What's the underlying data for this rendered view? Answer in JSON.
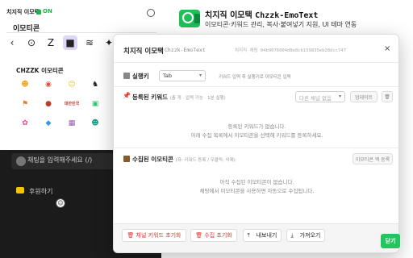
{
  "picker": {
    "title": "치지직 이모택",
    "status": "ON",
    "subtitle": "이모티콘",
    "section": "CHZZK 이모티콘",
    "tabs": [
      "‹",
      "⊙",
      "Z",
      "■",
      "≋",
      "✦"
    ],
    "emotes": [
      {
        "glyph": "☻",
        "color": "#f5a623"
      },
      {
        "glyph": "◉",
        "color": "#e74c3c"
      },
      {
        "glyph": "☺",
        "color": "#f1c40f"
      },
      {
        "glyph": "♞",
        "color": "#222"
      },
      {
        "glyph": "⚑",
        "color": "#e67e22"
      },
      {
        "glyph": "●",
        "color": "#c0392b"
      },
      {
        "glyph": "대한민국",
        "color": "#c0392b"
      },
      {
        "glyph": "▣",
        "color": "#2ecc71"
      },
      {
        "glyph": "✿",
        "color": "#e84393"
      },
      {
        "glyph": "◆",
        "color": "#3498db"
      },
      {
        "glyph": "▦",
        "color": "#9b59b6"
      },
      {
        "glyph": "☻",
        "color": "#16a085"
      }
    ],
    "input_placeholder": "채팅을 입력해주세요 (/)",
    "bottom_label": "후원하기"
  },
  "header": {
    "title": "치지직 이모택",
    "title_en": "Chzzk-EmoText",
    "description": "이모티콘·키워드 관리, 복사·붙여넣기 지원, UI 테마 연동"
  },
  "dialog": {
    "title": "치지직 이모택",
    "title_en": "Chzzk-EmoText",
    "channel_id": "치지직 채팅 04b9076004d8e8cb159835eb28dcc747",
    "close_glyph": "×",
    "hotkey": {
      "label": "실행키",
      "value": "Tab",
      "hint": "키워드 입력 후 실행키로 이모티콘 입력"
    },
    "keywords": {
      "label": "등록된 키워드",
      "sub": "(총 개 · 입력 가능 · 1분 실행)",
      "filter": "다른 채널 없음",
      "sort_btn": "업데이트",
      "empty1": "등록된 키워드가 없습니다.",
      "empty2": "아래 수집 목록에서 이모티콘을 선택해 키워드를 등록하세요."
    },
    "collected": {
      "label": "수집된 이모티콘",
      "sub": "(좌: 키워드 등록 / 우클릭: 삭제)",
      "btn": "이모티콘 액 등록",
      "empty1": "아직 수집된 이모티콘이 없습니다.",
      "empty2": "채팅에서 이모티콘을 사용하면 자동으로 수집됩니다."
    },
    "footer": {
      "reset_keywords": "채널 키워드 초기화",
      "reset_collected": "수집 초기화",
      "export": "내보내기",
      "import": "가져오기",
      "close": "닫기"
    }
  },
  "colors": {
    "accent": "#22c55e",
    "danger": "#dd3333",
    "dark_bg": "#1b1b1b"
  }
}
